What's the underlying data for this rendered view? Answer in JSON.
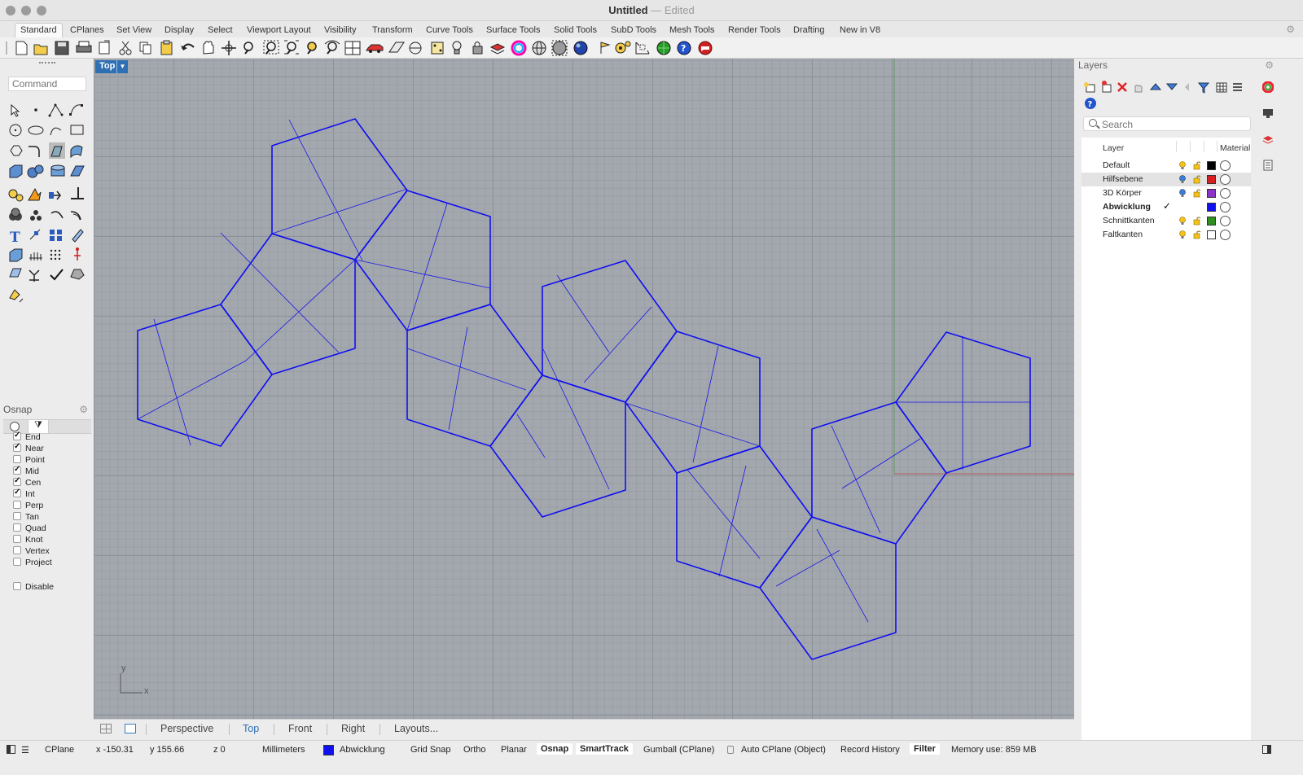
{
  "window": {
    "title": "Untitled",
    "separator": "—",
    "state": "Edited"
  },
  "tabs": [
    "Standard",
    "CPlanes",
    "Set View",
    "Display",
    "Select",
    "Viewport Layout",
    "Visibility",
    "Transform",
    "Curve Tools",
    "Surface Tools",
    "Solid Tools",
    "SubD Tools",
    "Mesh Tools",
    "Render Tools",
    "Drafting",
    "New in V8"
  ],
  "active_tab": "Standard",
  "command": {
    "placeholder": "Command"
  },
  "viewport": {
    "name": "Top",
    "axis_x": "x",
    "axis_y": "y",
    "curve_color": "#1010f0"
  },
  "viewport_tabs": [
    "Perspective",
    "Top",
    "Front",
    "Right",
    "Layouts..."
  ],
  "active_viewport_tab": "Top",
  "osnap": {
    "title": "Osnap",
    "items": [
      {
        "label": "End",
        "checked": true
      },
      {
        "label": "Near",
        "checked": true
      },
      {
        "label": "Point",
        "checked": false
      },
      {
        "label": "Mid",
        "checked": true
      },
      {
        "label": "Cen",
        "checked": true
      },
      {
        "label": "Int",
        "checked": true
      },
      {
        "label": "Perp",
        "checked": false
      },
      {
        "label": "Tan",
        "checked": false
      },
      {
        "label": "Quad",
        "checked": false
      },
      {
        "label": "Knot",
        "checked": false
      },
      {
        "label": "Vertex",
        "checked": false
      },
      {
        "label": "Project",
        "checked": false
      }
    ],
    "disable_label": "Disable"
  },
  "layers": {
    "title": "Layers",
    "search_placeholder": "Search",
    "col_layer": "Layer",
    "col_material": "Material",
    "rows": [
      {
        "name": "Default",
        "color": "#000000",
        "current": false,
        "selected": false,
        "bulb": "#f4c21a"
      },
      {
        "name": "Hilfsebene",
        "color": "#d81e1e",
        "current": false,
        "selected": true,
        "bulb": "#3c7dd9"
      },
      {
        "name": "3D Körper",
        "color": "#8a34c9",
        "current": false,
        "selected": false,
        "bulb": "#3c7dd9"
      },
      {
        "name": "Abwicklung",
        "color": "#1010f0",
        "current": true,
        "selected": false,
        "bulb": ""
      },
      {
        "name": "Schnittkanten",
        "color": "#2f8f1f",
        "current": false,
        "selected": false,
        "bulb": "#f4c21a"
      },
      {
        "name": "Faltkanten",
        "color": "#ffffff",
        "current": false,
        "selected": false,
        "bulb": "#f4c21a"
      }
    ],
    "current_mark": "✓"
  },
  "status": {
    "cplane": "CPlane",
    "x": "x -150.31",
    "y": "y 155.66",
    "z": "z 0",
    "units": "Millimeters",
    "layer": "Abwicklung",
    "layer_color": "#1010f0",
    "grid_snap": "Grid Snap",
    "ortho": "Ortho",
    "planar": "Planar",
    "osnap": "Osnap",
    "smarttrack": "SmartTrack",
    "gumball": "Gumball (CPlane)",
    "auto_cplane": "Auto CPlane (Object)",
    "record_history": "Record History",
    "filter": "Filter",
    "memory": "Memory use: 859 MB"
  }
}
